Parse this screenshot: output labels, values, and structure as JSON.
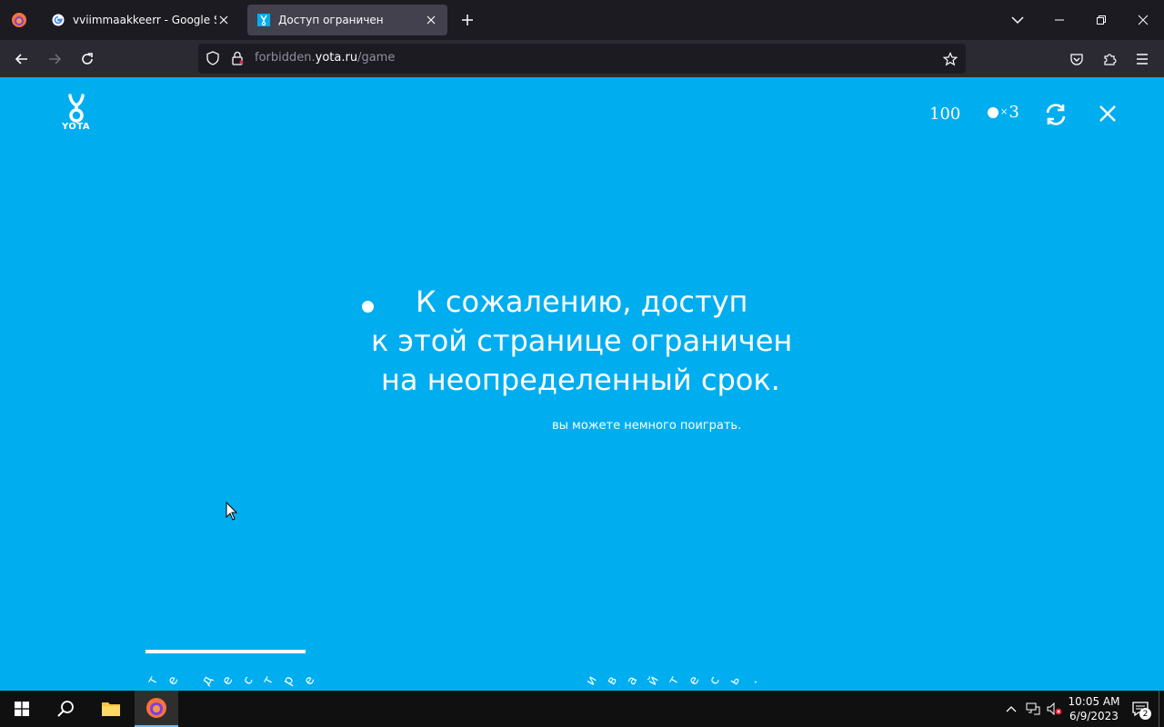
{
  "browser": {
    "tabs": [
      {
        "title": "vviimmaakkeerr - Google Searc",
        "active": false
      },
      {
        "title": "Доступ ограничен",
        "active": true
      }
    ],
    "url": {
      "prefix": "forbidden.",
      "host": "yota.ru",
      "path": "/game"
    }
  },
  "page": {
    "logo_text": "YOTA",
    "score": "100",
    "lives": "3",
    "message_lines": [
      "К сожалению, доступ",
      "к этой странице ограничен",
      "на неопределенный срок."
    ],
    "subtitle": "вы можете немного поиграть."
  },
  "taskbar": {
    "time": "10:05 AM",
    "date": "6/9/2023",
    "notification_count": "2"
  },
  "colors": {
    "page_bg": "#00aeef",
    "tab_bar": "#1c1b22",
    "nav_bar": "#2b2a33"
  }
}
